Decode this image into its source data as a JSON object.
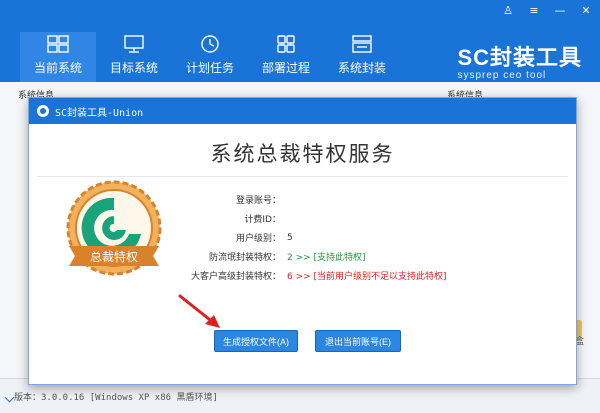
{
  "window": {
    "controls": [
      "♙",
      "≡",
      "—",
      "✕"
    ]
  },
  "nav": {
    "tabs": [
      {
        "label": "当前系统",
        "icon": "windows-icon",
        "active": true
      },
      {
        "label": "目标系统",
        "icon": "monitor-icon",
        "active": false
      },
      {
        "label": "计划任务",
        "icon": "clock-icon",
        "active": false
      },
      {
        "label": "部署过程",
        "icon": "grid-icon",
        "active": false
      },
      {
        "label": "系统封装",
        "icon": "package-icon",
        "active": false
      }
    ]
  },
  "logo": {
    "main": "SC封装工具",
    "sub": "sysprep ceo tool"
  },
  "background": {
    "left_section": "系统信息",
    "right_section": "系统信息",
    "side_text": "盒",
    "version": "版本：3.0.0.16 [Windows XP x86 黑盾环境]"
  },
  "dialog": {
    "title": "SC封装工具-Union",
    "heading": "系统总裁特权服务",
    "badge_text": "总裁特权",
    "rows": [
      {
        "label": "登录账号：",
        "value": ""
      },
      {
        "label": "计费ID：",
        "value": ""
      },
      {
        "label": "用户级别：",
        "value": "5"
      },
      {
        "label": "防流氓封装特权：",
        "value": "2 >> [支持此特权]"
      },
      {
        "label": "大客户高级封装特权：",
        "value": "6 >> [当前用户级别不足以支持此特权]"
      }
    ],
    "buttons": {
      "generate": "生成授权文件(A)",
      "exit": "退出当前账号(E)"
    }
  },
  "colors": {
    "primary": "#1a73d6",
    "badge_ring": "#d9822b",
    "badge_swirl": "#1aa37a",
    "arrow": "#e02020",
    "green_text": "#1a9a3a",
    "red_text": "#e02020"
  }
}
